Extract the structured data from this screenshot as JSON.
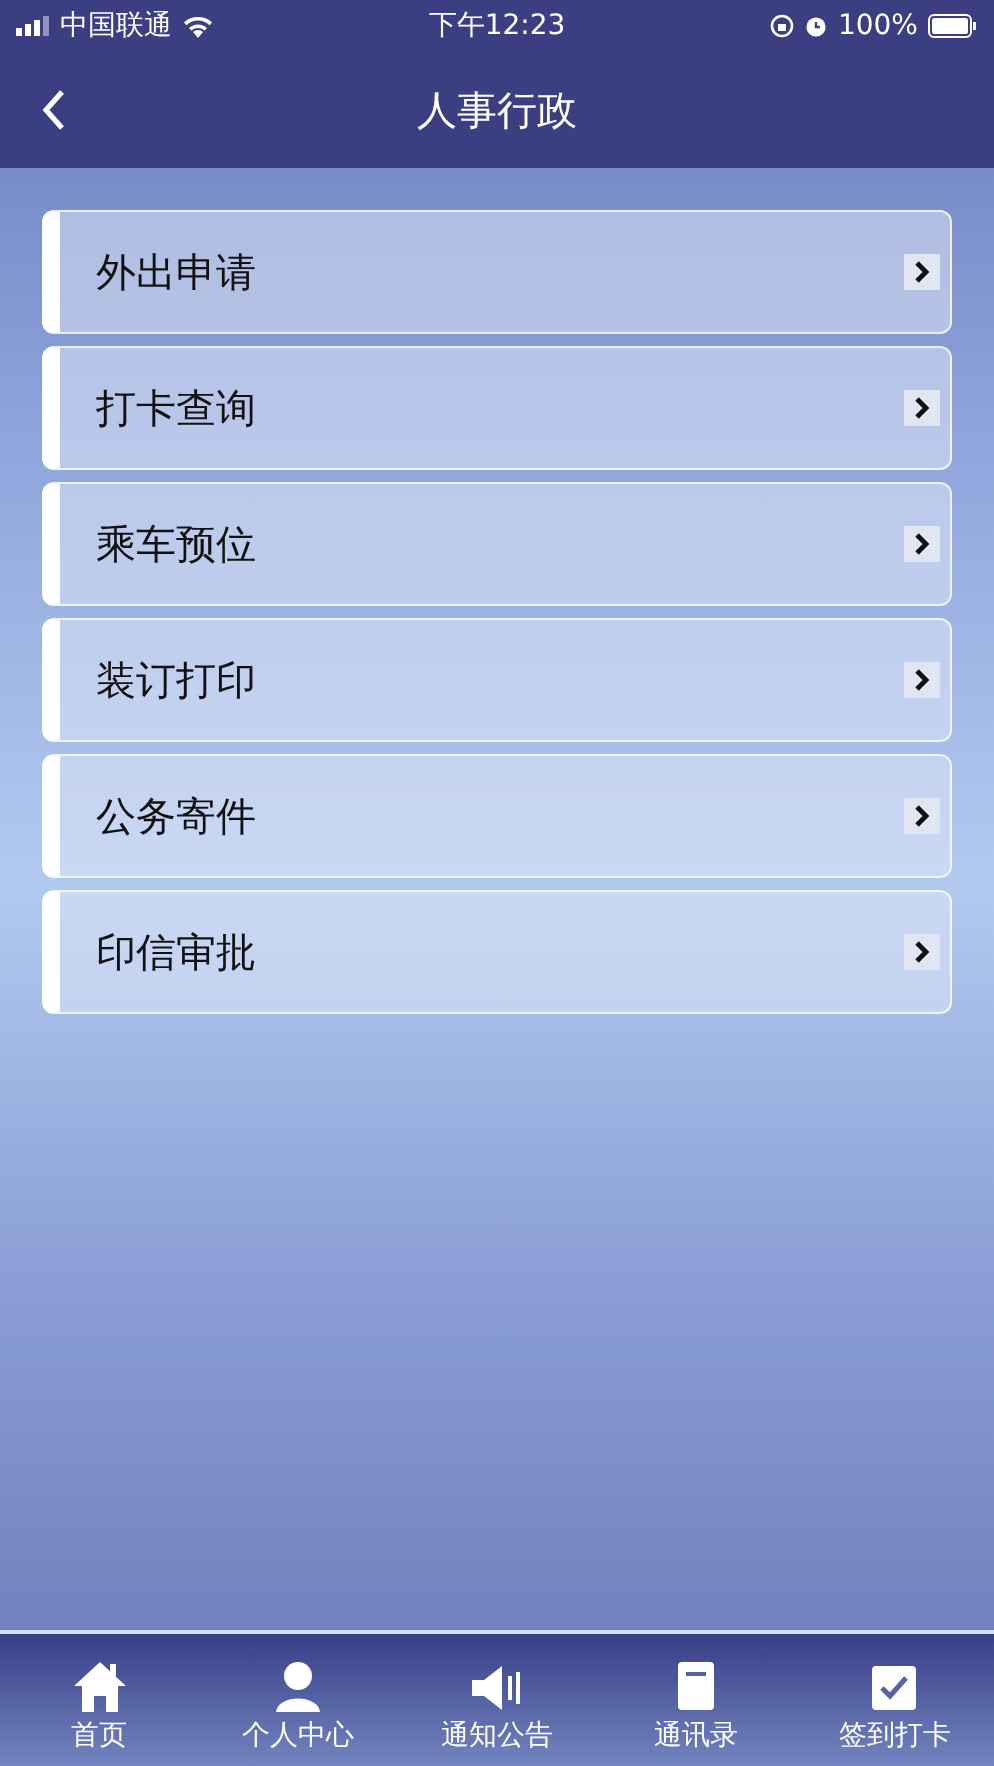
{
  "status_bar": {
    "carrier": "中国联通",
    "time": "下午12:23",
    "battery": "100%"
  },
  "nav": {
    "title": "人事行政"
  },
  "menu": [
    {
      "label": "外出申请"
    },
    {
      "label": "打卡查询"
    },
    {
      "label": "乘车预位"
    },
    {
      "label": "装订打印"
    },
    {
      "label": "公务寄件"
    },
    {
      "label": "印信审批"
    }
  ],
  "tab_bar": [
    {
      "label": "首页"
    },
    {
      "label": "个人中心"
    },
    {
      "label": "通知公告"
    },
    {
      "label": "通讯录"
    },
    {
      "label": "签到打卡"
    }
  ]
}
